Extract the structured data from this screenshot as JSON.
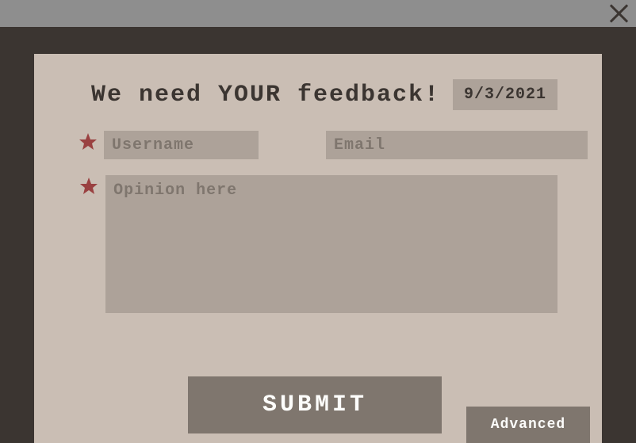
{
  "header": {
    "title": "We need YOUR feedback!",
    "date": "9/3/2021"
  },
  "form": {
    "username_placeholder": "Username",
    "email_placeholder": "Email",
    "opinion_placeholder": "Opinion here",
    "submit_label": "SUBMIT",
    "advanced_label": "Advanced"
  }
}
